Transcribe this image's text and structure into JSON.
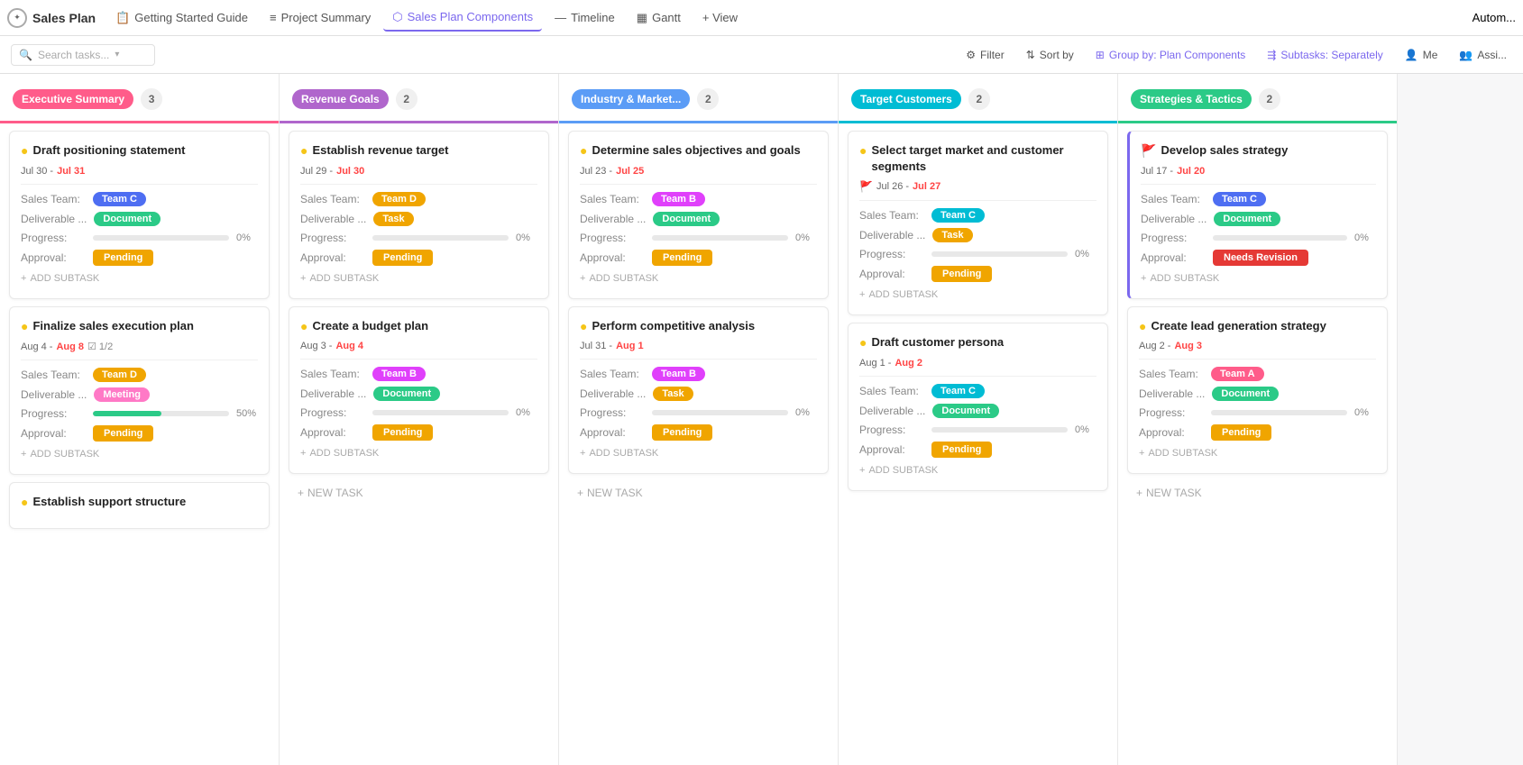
{
  "app": {
    "title": "Sales Plan",
    "logo_char": "✦"
  },
  "nav": {
    "tabs": [
      {
        "id": "getting-started",
        "label": "Getting Started Guide",
        "icon": "📋",
        "active": false
      },
      {
        "id": "project-summary",
        "label": "Project Summary",
        "icon": "≡",
        "active": false
      },
      {
        "id": "sales-plan-components",
        "label": "Sales Plan Components",
        "icon": "⬡",
        "active": true
      },
      {
        "id": "timeline",
        "label": "Timeline",
        "icon": "—",
        "active": false
      },
      {
        "id": "gantt",
        "label": "Gantt",
        "icon": "▦",
        "active": false
      },
      {
        "id": "view",
        "label": "+ View",
        "icon": "",
        "active": false
      }
    ],
    "right": "Autom..."
  },
  "toolbar": {
    "search_placeholder": "Search tasks...",
    "filter_label": "Filter",
    "sort_label": "Sort by",
    "group_label": "Group by: Plan Components",
    "subtasks_label": "Subtasks: Separately",
    "me_label": "Me",
    "assign_label": "Assi..."
  },
  "columns": [
    {
      "id": "executive-summary",
      "label": "Executive Summary",
      "color": "pink",
      "count": 3,
      "cards": [
        {
          "id": "draft-positioning",
          "title": "Draft positioning statement",
          "title_icon": "●",
          "icon_color": "yellow",
          "date_start": "Jul 30",
          "date_end": "Jul 31",
          "date_overdue": true,
          "sales_team_label": "Sales Team:",
          "sales_team": "Team C",
          "team_color": "team-c",
          "deliverable_label": "Deliverable ...",
          "deliverable": "Document",
          "deliverable_color": "document",
          "progress": 0,
          "approval": "Pending",
          "approval_type": "pending",
          "add_subtask": "+ ADD SUBTASK",
          "has_left_border": false
        },
        {
          "id": "finalize-sales",
          "title": "Finalize sales execution plan",
          "title_icon": "●",
          "icon_color": "yellow",
          "date_start": "Aug 4",
          "date_end": "Aug 8",
          "date_overdue": true,
          "has_subtask_count": true,
          "subtask_count": "1/2",
          "sales_team_label": "Sales Team:",
          "sales_team": "Team D",
          "team_color": "team-d",
          "deliverable_label": "Deliverable ...",
          "deliverable": "Meeting",
          "deliverable_color": "meeting",
          "progress": 50,
          "approval": "Pending",
          "approval_type": "pending",
          "add_subtask": "+ ADD SUBTASK",
          "has_left_border": false
        },
        {
          "id": "establish-support",
          "title": "Establish support structure",
          "title_icon": "●",
          "icon_color": "yellow",
          "partial": true
        }
      ],
      "new_task_label": ""
    },
    {
      "id": "revenue-goals",
      "label": "Revenue Goals",
      "color": "purple",
      "count": 2,
      "cards": [
        {
          "id": "establish-revenue",
          "title": "Establish revenue target",
          "title_icon": "●",
          "icon_color": "yellow",
          "date_start": "Jul 29",
          "date_end": "Jul 30",
          "date_overdue": true,
          "sales_team_label": "Sales Team:",
          "sales_team": "Team D",
          "team_color": "team-d",
          "deliverable_label": "Deliverable ...",
          "deliverable": "Task",
          "deliverable_color": "task",
          "progress": 0,
          "approval": "Pending",
          "approval_type": "pending",
          "add_subtask": "+ ADD SUBTASK",
          "has_left_border": false
        },
        {
          "id": "create-budget",
          "title": "Create a budget plan",
          "title_icon": "●",
          "icon_color": "yellow",
          "date_start": "Aug 3",
          "date_end": "Aug 4",
          "date_overdue": true,
          "sales_team_label": "Sales Team:",
          "sales_team": "Team B",
          "team_color": "team-b",
          "deliverable_label": "Deliverable ...",
          "deliverable": "Document",
          "deliverable_color": "document",
          "progress": 0,
          "approval": "Pending",
          "approval_type": "pending",
          "add_subtask": "+ ADD SUBTASK",
          "has_left_border": false
        }
      ],
      "new_task_label": "+ NEW TASK"
    },
    {
      "id": "industry-market",
      "label": "Industry & Market...",
      "color": "blue",
      "count": 2,
      "cards": [
        {
          "id": "determine-sales",
          "title": "Determine sales objectives and goals",
          "title_icon": "●",
          "icon_color": "yellow",
          "date_start": "Jul 23",
          "date_end": "Jul 25",
          "date_overdue": true,
          "sales_team_label": "Sales Team:",
          "sales_team": "Team B",
          "team_color": "team-b",
          "deliverable_label": "Deliverable ...",
          "deliverable": "Document",
          "deliverable_color": "document",
          "progress": 0,
          "approval": "Pending",
          "approval_type": "pending",
          "add_subtask": "+ ADD SUBTASK",
          "has_left_border": false
        },
        {
          "id": "perform-competitive",
          "title": "Perform competitive analysis",
          "title_icon": "●",
          "icon_color": "yellow",
          "date_start": "Jul 31",
          "date_end": "Aug 1",
          "date_overdue": true,
          "sales_team_label": "Sales Team:",
          "sales_team": "Team B",
          "team_color": "team-b",
          "deliverable_label": "Deliverable ...",
          "deliverable": "Task",
          "deliverable_color": "task",
          "progress": 0,
          "approval": "Pending",
          "approval_type": "pending",
          "add_subtask": "+ ADD SUBTASK",
          "has_left_border": false
        }
      ],
      "new_task_label": "+ NEW TASK"
    },
    {
      "id": "target-customers",
      "label": "Target Customers",
      "color": "teal",
      "count": 2,
      "cards": [
        {
          "id": "select-target-market",
          "title": "Select target market and customer segments",
          "title_icon": "●",
          "icon_color": "yellow",
          "has_flag": true,
          "date_start": "Jul 26",
          "date_end": "Jul 27",
          "date_overdue": true,
          "sales_team_label": "Sales Team:",
          "sales_team": "Team C",
          "team_color": "team-c2",
          "deliverable_label": "Deliverable ...",
          "deliverable": "Task",
          "deliverable_color": "task",
          "progress": 0,
          "approval": "Pending",
          "approval_type": "pending",
          "add_subtask": "+ ADD SUBTASK",
          "has_left_border": false
        },
        {
          "id": "draft-customer-persona",
          "title": "Draft customer persona",
          "title_icon": "●",
          "icon_color": "yellow",
          "date_start": "Aug 1",
          "date_end": "Aug 2",
          "date_overdue": true,
          "sales_team_label": "Sales Team:",
          "sales_team": "Team C",
          "team_color": "team-c2",
          "deliverable_label": "Deliverable ...",
          "deliverable": "Document",
          "deliverable_color": "document",
          "progress": 0,
          "approval": "Pending",
          "approval_type": "pending",
          "add_subtask": "+ ADD SUBTASK",
          "has_left_border": false
        }
      ],
      "new_task_label": ""
    },
    {
      "id": "strategies-tactics",
      "label": "Strategies & Tactics",
      "color": "green",
      "count": 2,
      "cards": [
        {
          "id": "develop-sales-strategy",
          "title": "Develop sales strategy",
          "title_icon": "🚩",
          "icon_color": "red",
          "date_start": "Jul 17",
          "date_end": "Jul 20",
          "date_overdue": true,
          "sales_team_label": "Sales Team:",
          "sales_team": "Team C",
          "team_color": "team-c",
          "deliverable_label": "Deliverable ...",
          "deliverable": "Document",
          "deliverable_color": "document",
          "progress": 0,
          "approval": "Needs Revision",
          "approval_type": "needs-revision",
          "add_subtask": "+ ADD SUBTASK",
          "has_left_border": true
        },
        {
          "id": "create-lead-generation",
          "title": "Create lead generation strategy",
          "title_icon": "●",
          "icon_color": "yellow",
          "date_start": "Aug 2",
          "date_end": "Aug 3",
          "date_overdue": true,
          "sales_team_label": "Sales Team:",
          "sales_team": "Team A",
          "team_color": "team-a",
          "deliverable_label": "Deliverable ...",
          "deliverable": "Document",
          "deliverable_color": "document",
          "progress": 0,
          "approval": "Pending",
          "approval_type": "pending",
          "add_subtask": "+ ADD SUBTASK",
          "has_left_border": false
        }
      ],
      "new_task_label": "+ NEW TASK"
    }
  ]
}
